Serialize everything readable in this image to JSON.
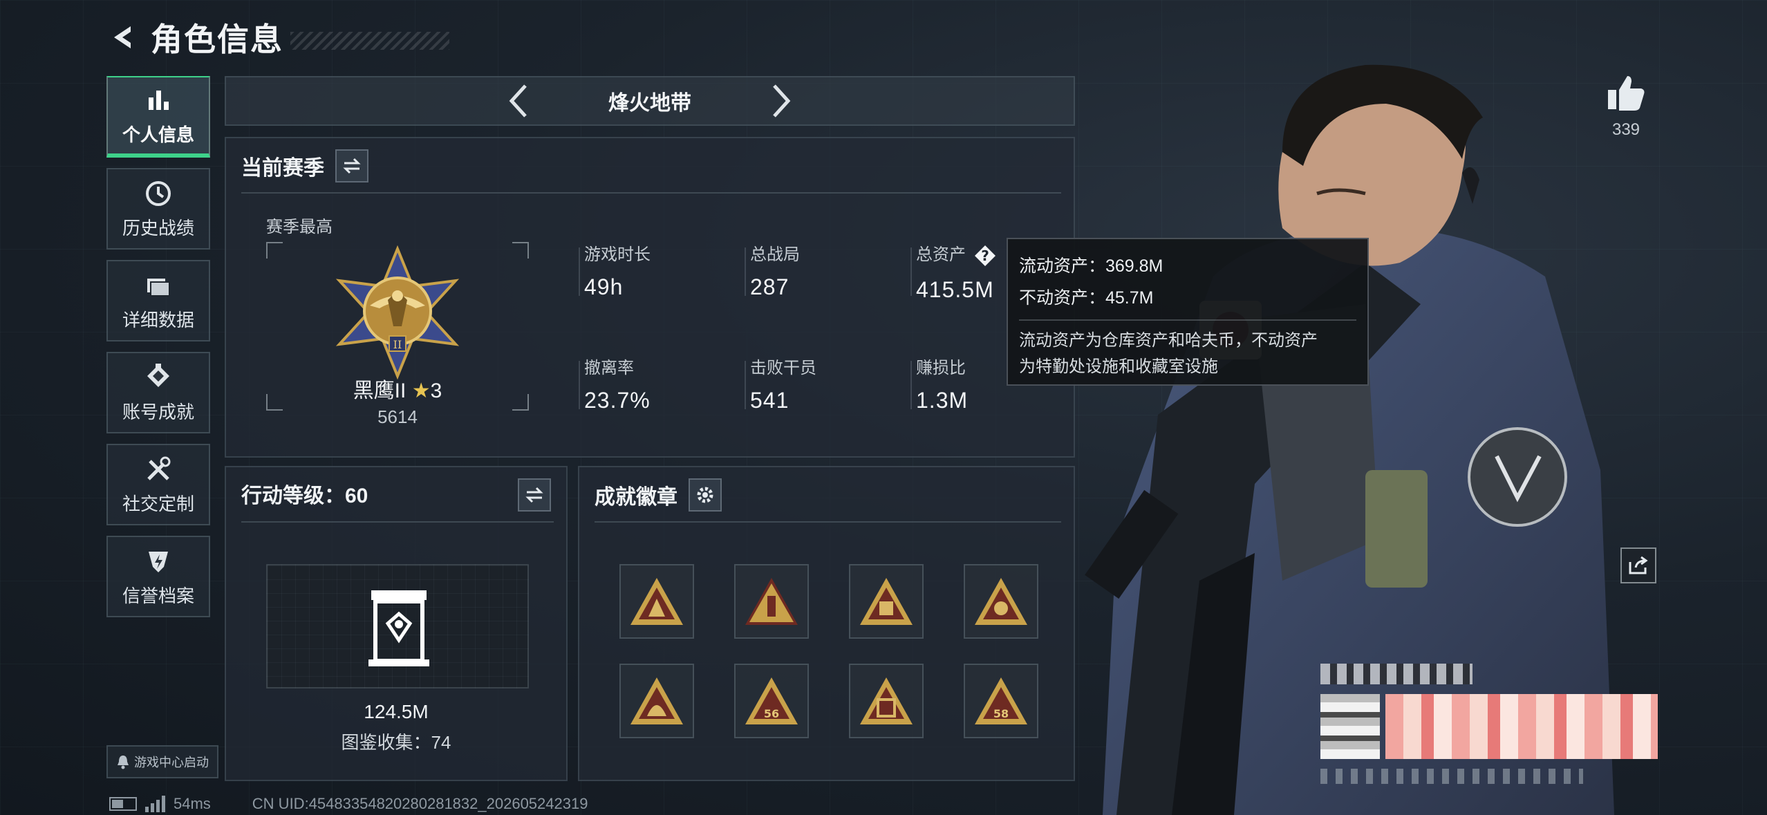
{
  "header": {
    "title": "角色信息"
  },
  "sidebar": {
    "items": [
      {
        "label": "个人信息",
        "icon": "bar-chart-icon",
        "active": true
      },
      {
        "label": "历史战绩",
        "icon": "history-icon",
        "active": false
      },
      {
        "label": "详细数据",
        "icon": "folder-icon",
        "active": false
      },
      {
        "label": "账号成就",
        "icon": "achievement-icon",
        "active": false
      },
      {
        "label": "社交定制",
        "icon": "tools-icon",
        "active": false
      },
      {
        "label": "信誉档案",
        "icon": "credit-shield-icon",
        "active": false
      }
    ],
    "launch_label": "游戏中心启动"
  },
  "mode_nav": {
    "title": "烽火地带"
  },
  "season": {
    "title": "当前赛季",
    "best_label": "赛季最高",
    "rank_name": "黑鹰II",
    "rank_stars": "3",
    "rank_score": "5614",
    "stats": [
      {
        "label": "游戏时长",
        "value": "49h"
      },
      {
        "label": "总战局",
        "value": "287"
      },
      {
        "label": "总资产",
        "value": "415.5M"
      },
      {
        "label": "撤离率",
        "value": "23.7%"
      },
      {
        "label": "击败干员",
        "value": "541"
      },
      {
        "label": "赚损比",
        "value": "1.3M"
      }
    ]
  },
  "tooltip": {
    "liquid": "流动资产：369.8M",
    "fixed": "不动资产：45.7M",
    "note_line1": "流动资产为仓库资产和哈夫币，不动资产",
    "note_line2": "为特勤处设施和收藏室设施"
  },
  "level": {
    "title": "行动等级：60",
    "value": "124.5M",
    "collection": "图鉴收集：74"
  },
  "badges": {
    "title": "成就徽章",
    "items": [
      "badge-1",
      "badge-2",
      "badge-3",
      "badge-4",
      "badge-5",
      "badge-6",
      "badge-7",
      "badge-8"
    ],
    "labels": {
      "badge-6": "56",
      "badge-8": "58"
    }
  },
  "social": {
    "likes": "339"
  },
  "footer": {
    "ping": "54ms",
    "uid": "CN UID:4548335482028028​1832_202605242319"
  },
  "colors": {
    "accent": "#3ed28a",
    "gold": "#c9a24a",
    "background": "#1b232c"
  }
}
